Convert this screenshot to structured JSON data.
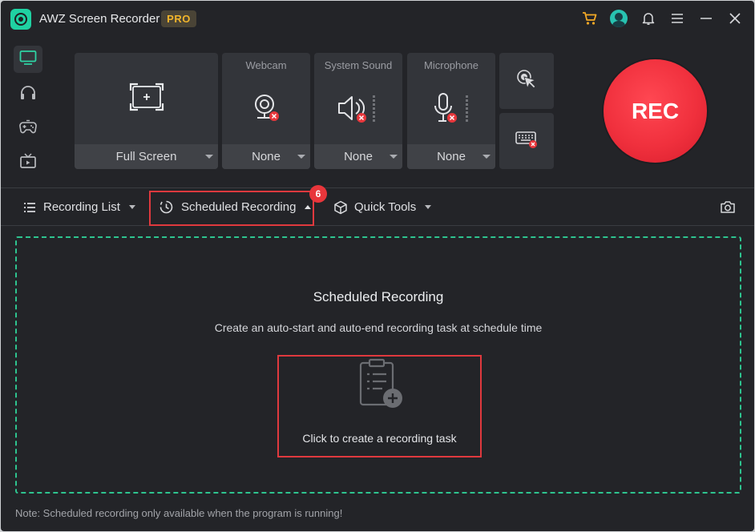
{
  "app": {
    "title": "AWZ Screen Recorder",
    "badge": "PRO"
  },
  "titlebar_icons": [
    "cart-icon",
    "avatar",
    "bell-icon",
    "menu-icon",
    "minimize-icon",
    "close-icon"
  ],
  "rail": {
    "items": [
      {
        "name": "screen-icon",
        "active": true
      },
      {
        "name": "headphones-icon",
        "active": false
      },
      {
        "name": "gamepad-icon",
        "active": false
      },
      {
        "name": "tv-icon",
        "active": false
      }
    ]
  },
  "sources": {
    "screen": {
      "value": "Full Screen"
    },
    "webcam": {
      "label": "Webcam",
      "value": "None"
    },
    "system_sound": {
      "label": "System Sound",
      "value": "None"
    },
    "microphone": {
      "label": "Microphone",
      "value": "None"
    }
  },
  "rec_button": {
    "label": "REC"
  },
  "toolbar": {
    "recording_list": "Recording List",
    "scheduled_recording": "Scheduled Recording",
    "quick_tools": "Quick Tools",
    "step_badge": "6"
  },
  "panel": {
    "title": "Scheduled Recording",
    "description": "Create an auto-start and auto-end recording task at schedule time",
    "create_task_label": "Click to create a recording task"
  },
  "note": "Note: Scheduled recording only available when the program is running!",
  "colors": {
    "accent_green": "#2ec48f",
    "logo_teal": "#1fd1a2",
    "rec_red": "#f0303d",
    "highlight_red": "#e0393e",
    "pro_gold": "#f2b52b",
    "background": "#232428"
  }
}
